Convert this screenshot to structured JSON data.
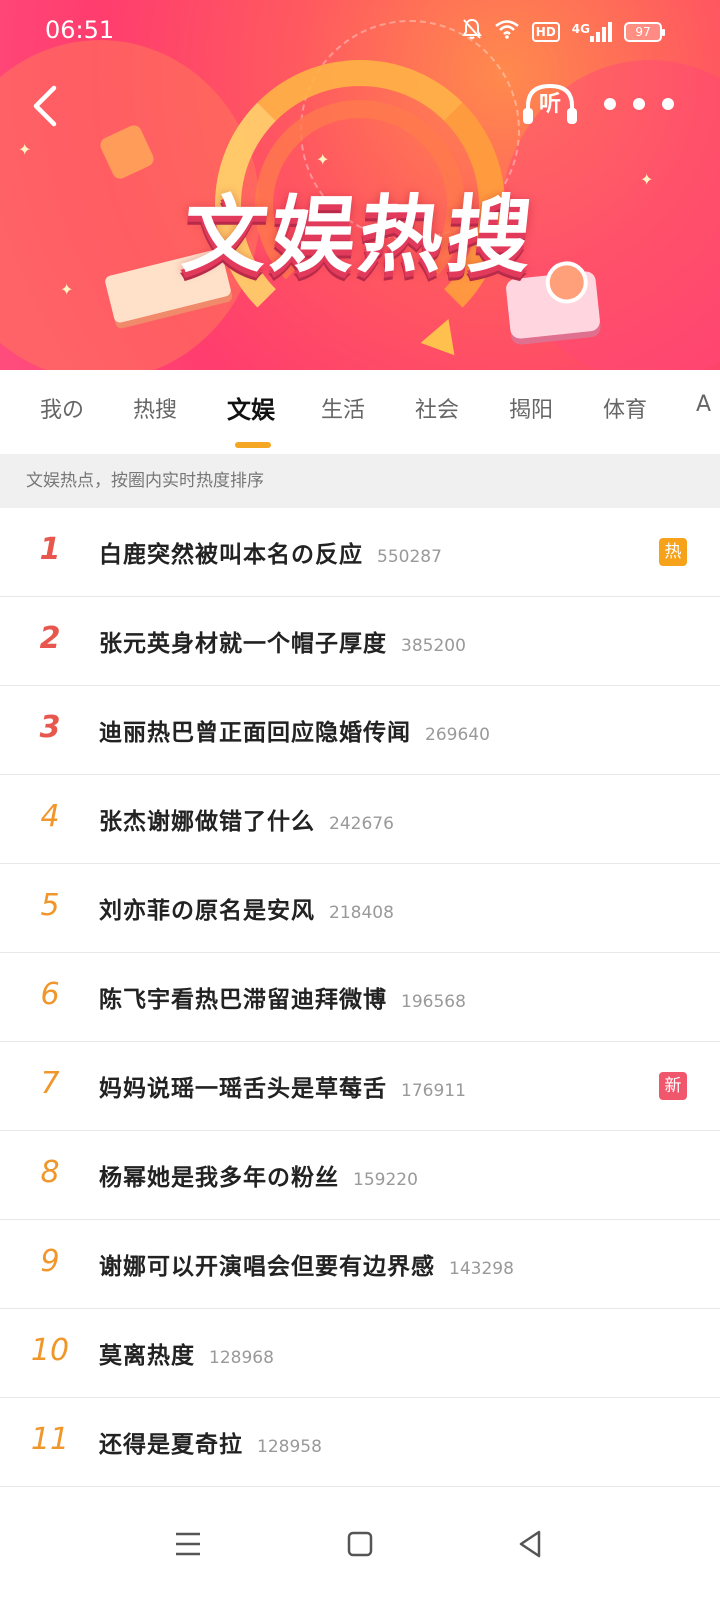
{
  "status_bar": {
    "time": "06:51",
    "hd_label": "HD",
    "network_label": "4G",
    "battery_level": "97"
  },
  "banner": {
    "title": "文娱热搜",
    "listen_label": "听",
    "colors": {
      "primary": "#ff3d6e",
      "accent": "#ffb347"
    }
  },
  "tabs": [
    {
      "label": "我の"
    },
    {
      "label": "热搜"
    },
    {
      "label": "文娱"
    },
    {
      "label": "生活"
    },
    {
      "label": "社会"
    },
    {
      "label": "揭阳"
    },
    {
      "label": "体育"
    },
    {
      "label": "A"
    }
  ],
  "active_tab": "文娱",
  "hint": "文娱热点，按圈内实时热度排序",
  "items": [
    {
      "rank": "1",
      "title": "白鹿突然被叫本名の反应",
      "count": "550287",
      "badge": "热"
    },
    {
      "rank": "2",
      "title": "张元英身材就一个帽子厚度",
      "count": "385200",
      "badge": ""
    },
    {
      "rank": "3",
      "title": "迪丽热巴曾正面回应隐婚传闻",
      "count": "269640",
      "badge": ""
    },
    {
      "rank": "4",
      "title": "张杰谢娜做错了什么",
      "count": "242676",
      "badge": ""
    },
    {
      "rank": "5",
      "title": "刘亦菲の原名是安风",
      "count": "218408",
      "badge": ""
    },
    {
      "rank": "6",
      "title": "陈飞宇看热巴滞留迪拜微博",
      "count": "196568",
      "badge": ""
    },
    {
      "rank": "7",
      "title": "妈妈说瑶一瑶舌头是草莓舌",
      "count": "176911",
      "badge": "新"
    },
    {
      "rank": "8",
      "title": "杨幂她是我多年の粉丝",
      "count": "159220",
      "badge": ""
    },
    {
      "rank": "9",
      "title": "谢娜可以开演唱会但要有边界感",
      "count": "143298",
      "badge": ""
    },
    {
      "rank": "10",
      "title": "莫离热度",
      "count": "128968",
      "badge": ""
    },
    {
      "rank": "11",
      "title": "还得是夏奇拉",
      "count": "128958",
      "badge": ""
    }
  ],
  "colors": {
    "rank_top": "#e8574e",
    "rank_other": "#f0962a",
    "badge_hot": "#f7a21b",
    "badge_new": "#f0566c",
    "tab_underline": "#f5a623"
  },
  "icons": {
    "back": "back-arrow-icon",
    "listen": "headphones-icon",
    "more": "more-dots-icon",
    "nav_menu": "menu-icon",
    "nav_home": "home-square-icon",
    "nav_back": "back-triangle-icon"
  }
}
